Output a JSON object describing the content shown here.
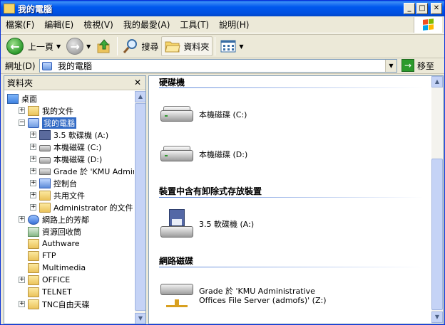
{
  "window": {
    "title": "我的電腦"
  },
  "titlebar_buttons": {
    "minimize": "_",
    "maximize": "□",
    "close": "✕"
  },
  "menu": [
    "檔案(F)",
    "編輯(E)",
    "檢視(V)",
    "我的最愛(A)",
    "工具(T)",
    "說明(H)"
  ],
  "toolbar": {
    "back_label": "上一頁",
    "search_label": "搜尋",
    "folders_label": "資料夾"
  },
  "address": {
    "label": "網址(D)",
    "value": "我的電腦",
    "go_label": "移至"
  },
  "folder_pane": {
    "title": "資料夾",
    "tree": [
      {
        "label": "桌面",
        "icon": "desktop-icon",
        "indent": 0,
        "expander": ""
      },
      {
        "label": "我的文件",
        "icon": "my-documents-icon",
        "indent": 1,
        "expander": "+"
      },
      {
        "label": "我的電腦",
        "icon": "my-computer-icon",
        "indent": 1,
        "expander": "−",
        "selected": true
      },
      {
        "label": "3.5 軟碟機 (A:)",
        "icon": "floppy-icon",
        "indent": 2,
        "expander": "+"
      },
      {
        "label": "本機磁碟 (C:)",
        "icon": "hard-drive-icon",
        "indent": 2,
        "expander": "+"
      },
      {
        "label": "本機磁碟 (D:)",
        "icon": "hard-drive-icon",
        "indent": 2,
        "expander": "+"
      },
      {
        "label": "Grade 於 'KMU Administ",
        "icon": "network-drive-icon",
        "indent": 2,
        "expander": "+"
      },
      {
        "label": "控制台",
        "icon": "control-panel-icon",
        "indent": 2,
        "expander": "+"
      },
      {
        "label": "共用文件",
        "icon": "folder-icon",
        "indent": 2,
        "expander": "+"
      },
      {
        "label": "Administrator 的文件",
        "icon": "folder-icon",
        "indent": 2,
        "expander": "+"
      },
      {
        "label": "網路上的芳鄰",
        "icon": "network-icon",
        "indent": 1,
        "expander": "+"
      },
      {
        "label": "資源回收筒",
        "icon": "recycle-bin-icon",
        "indent": 1,
        "expander": ""
      },
      {
        "label": "Authware",
        "icon": "folder-icon",
        "indent": 1,
        "expander": ""
      },
      {
        "label": "FTP",
        "icon": "folder-icon",
        "indent": 1,
        "expander": ""
      },
      {
        "label": "Multimedia",
        "icon": "folder-icon",
        "indent": 1,
        "expander": ""
      },
      {
        "label": "OFFICE",
        "icon": "folder-icon",
        "indent": 1,
        "expander": "+"
      },
      {
        "label": "TELNET",
        "icon": "folder-icon",
        "indent": 1,
        "expander": ""
      },
      {
        "label": "TNC自由天碟",
        "icon": "folder-icon",
        "indent": 1,
        "expander": "+"
      }
    ]
  },
  "content": {
    "groups": [
      {
        "header": "硬碟機",
        "items": [
          "本機磁碟 (C:)",
          "本機磁碟 (D:)"
        ]
      },
      {
        "header": "裝置中含有卸除式存放裝置",
        "items": [
          "3.5 軟碟機 (A:)"
        ]
      },
      {
        "header": "網路磁碟",
        "items": [
          "Grade 於 'KMU Administrative",
          "Offices File Server (admofs)' (Z:)"
        ]
      }
    ]
  },
  "colors": {
    "titlebar": "#0058EE",
    "selection": "#316AC5",
    "group_line": "#4E7CD6"
  }
}
